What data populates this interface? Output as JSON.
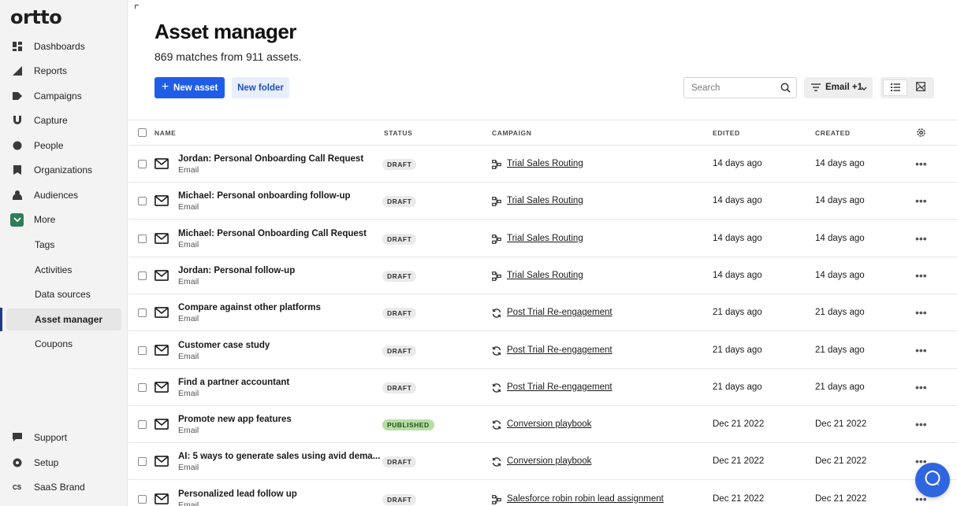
{
  "app": {
    "logo": "ortto"
  },
  "sidebar": {
    "items": [
      {
        "label": "Dashboards",
        "icon": "dashboard-icon"
      },
      {
        "label": "Reports",
        "icon": "reports-icon"
      },
      {
        "label": "Campaigns",
        "icon": "campaigns-icon"
      },
      {
        "label": "Capture",
        "icon": "capture-icon"
      },
      {
        "label": "People",
        "icon": "people-icon"
      },
      {
        "label": "Organizations",
        "icon": "organizations-icon"
      },
      {
        "label": "Audiences",
        "icon": "audiences-icon"
      },
      {
        "label": "More",
        "icon": "chevron-down-icon"
      }
    ],
    "sub_items": [
      {
        "label": "Tags"
      },
      {
        "label": "Activities"
      },
      {
        "label": "Data sources"
      },
      {
        "label": "Asset manager",
        "active": true
      },
      {
        "label": "Coupons"
      }
    ],
    "bottom_items": [
      {
        "label": "Support",
        "icon": "support-icon"
      },
      {
        "label": "Setup",
        "icon": "gear-icon"
      },
      {
        "label": "SaaS Brand",
        "avatar": "CS"
      }
    ]
  },
  "header": {
    "title": "Asset manager",
    "subtitle": "869 matches from 911 assets."
  },
  "toolbar": {
    "new_asset_label": "New asset",
    "new_folder_label": "New folder",
    "search_placeholder": "Search",
    "filter_label": "Email +1"
  },
  "table": {
    "columns": [
      "NAME",
      "STATUS",
      "CAMPAIGN",
      "EDITED",
      "CREATED"
    ],
    "rows": [
      {
        "name": "Jordan: Personal Onboarding Call Request",
        "type": "Email",
        "status": "DRAFT",
        "campaign": "Trial Sales Routing",
        "campaign_icon": "journey-icon",
        "edited": "14 days ago",
        "created": "14 days ago"
      },
      {
        "name": "Michael: Personal onboarding follow-up",
        "type": "Email",
        "status": "DRAFT",
        "campaign": "Trial Sales Routing",
        "campaign_icon": "journey-icon",
        "edited": "14 days ago",
        "created": "14 days ago"
      },
      {
        "name": "Michael: Personal Onboarding Call Request",
        "type": "Email",
        "status": "DRAFT",
        "campaign": "Trial Sales Routing",
        "campaign_icon": "journey-icon",
        "edited": "14 days ago",
        "created": "14 days ago"
      },
      {
        "name": "Jordan: Personal follow-up",
        "type": "Email",
        "status": "DRAFT",
        "campaign": "Trial Sales Routing",
        "campaign_icon": "journey-icon",
        "edited": "14 days ago",
        "created": "14 days ago"
      },
      {
        "name": "Compare against other platforms",
        "type": "Email",
        "status": "DRAFT",
        "campaign": "Post Trial Re-engagement",
        "campaign_icon": "playbook-icon",
        "edited": "21 days ago",
        "created": "21 days ago"
      },
      {
        "name": "Customer case study",
        "type": "Email",
        "status": "DRAFT",
        "campaign": "Post Trial Re-engagement",
        "campaign_icon": "playbook-icon",
        "edited": "21 days ago",
        "created": "21 days ago"
      },
      {
        "name": "Find a partner accountant",
        "type": "Email",
        "status": "DRAFT",
        "campaign": "Post Trial Re-engagement",
        "campaign_icon": "playbook-icon",
        "edited": "21 days ago",
        "created": "21 days ago"
      },
      {
        "name": "Promote new app features",
        "type": "Email",
        "status": "PUBLISHED",
        "campaign": "Conversion playbook",
        "campaign_icon": "playbook-icon",
        "edited": "Dec 21 2022",
        "created": "Dec 21 2022"
      },
      {
        "name": "AI: 5 ways to generate sales using avid dema...",
        "type": "Email",
        "status": "DRAFT",
        "campaign": "Conversion playbook",
        "campaign_icon": "playbook-icon",
        "edited": "Dec 21 2022",
        "created": "Dec 21 2022"
      },
      {
        "name": "Personalized lead follow up",
        "type": "Email",
        "status": "DRAFT",
        "campaign": "Salesforce robin robin lead assignment",
        "campaign_icon": "journey-icon",
        "edited": "Dec 21 2022",
        "created": "Dec 21 2022"
      }
    ]
  },
  "colors": {
    "primary": "#1f5de8",
    "published": "#b5dea5",
    "more_chip": "#2f7d5a",
    "chat": "#2f66e0"
  }
}
